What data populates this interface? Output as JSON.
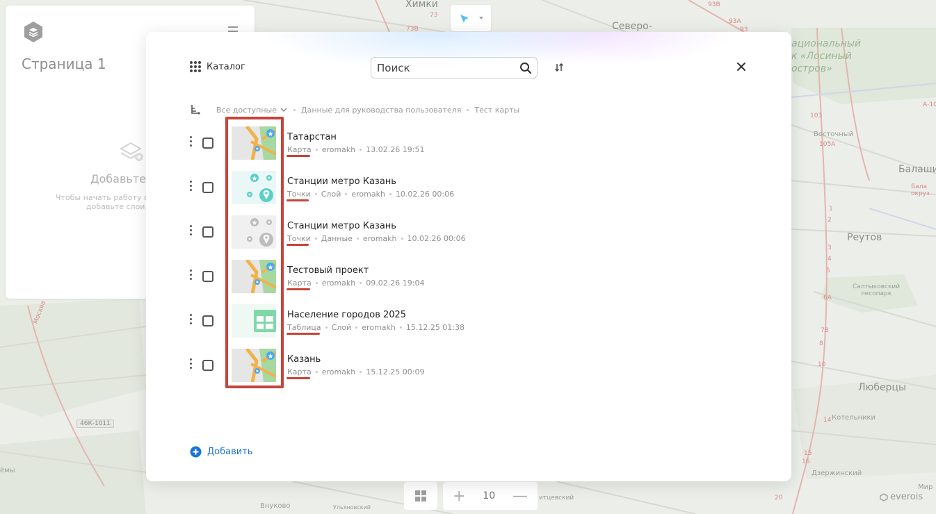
{
  "map": {
    "labels": [
      "Химки",
      "Северо-",
      "Восточный",
      "Балаши",
      "Реутов",
      "Салтыковский лесопарк",
      "Люберцы",
      "Котельники",
      "Дзержинский",
      "Внуково",
      "Мир",
      "Ульяновский",
      "итцевский",
      "ёмы",
      "Москва"
    ],
    "park_label": "ациональный к «Лосиный остров»",
    "road_labels": [
      "93В",
      "93А",
      "93",
      "73В",
      "73",
      "105А",
      "103",
      "А-10",
      "1",
      "2",
      "3",
      "4",
      "5",
      "6А",
      "7В",
      "8",
      "10",
      "14",
      "15",
      "16",
      "20",
      "Бала окруз"
    ],
    "badge": "46К-1011"
  },
  "side_panel": {
    "title": "Страница 1",
    "empty_title": "Добавьте с",
    "empty_text_line1": "Чтобы начать работу с",
    "empty_text_line2": "добавьте слои"
  },
  "toolbar": {
    "zoom_in": "+",
    "zoom_value": "10",
    "zoom_out": "—",
    "attribution": "everois"
  },
  "catalog": {
    "title": "Каталог",
    "search_placeholder": "Поиск",
    "breadcrumb": {
      "all": "Все доступные",
      "items": [
        "Данные для руководства пользователя",
        "Тест карты"
      ]
    },
    "add_label": "Добавить",
    "items": [
      {
        "title": "Татарстан",
        "type": "Карта",
        "meta": [
          "eromakh",
          "13.02.26 19:51"
        ],
        "thumb": "map"
      },
      {
        "title": "Станции метро Казань",
        "type": "Точки",
        "meta": [
          "Слой",
          "eromakh",
          "10.02.26 00:06"
        ],
        "thumb": "points-teal"
      },
      {
        "title": "Станции метро Казань",
        "type": "Точки",
        "meta": [
          "Данные",
          "eromakh",
          "10.02.26 00:06"
        ],
        "thumb": "points-gray"
      },
      {
        "title": "Тестовый проект",
        "type": "Карта",
        "meta": [
          "eromakh",
          "09.02.26 19:04"
        ],
        "thumb": "map"
      },
      {
        "title": "Население городов 2025",
        "type": "Таблица",
        "meta": [
          "Слой",
          "eromakh",
          "15.12.25 01:38"
        ],
        "thumb": "table"
      },
      {
        "title": "Казань",
        "type": "Карта",
        "meta": [
          "eromakh",
          "15.12.25 00:09"
        ],
        "thumb": "map"
      }
    ]
  },
  "colors": {
    "accent_blue": "#1976d2",
    "highlight_red": "#c8433a",
    "teal": "#5bd0c8",
    "table_green": "#7ed8a8"
  }
}
